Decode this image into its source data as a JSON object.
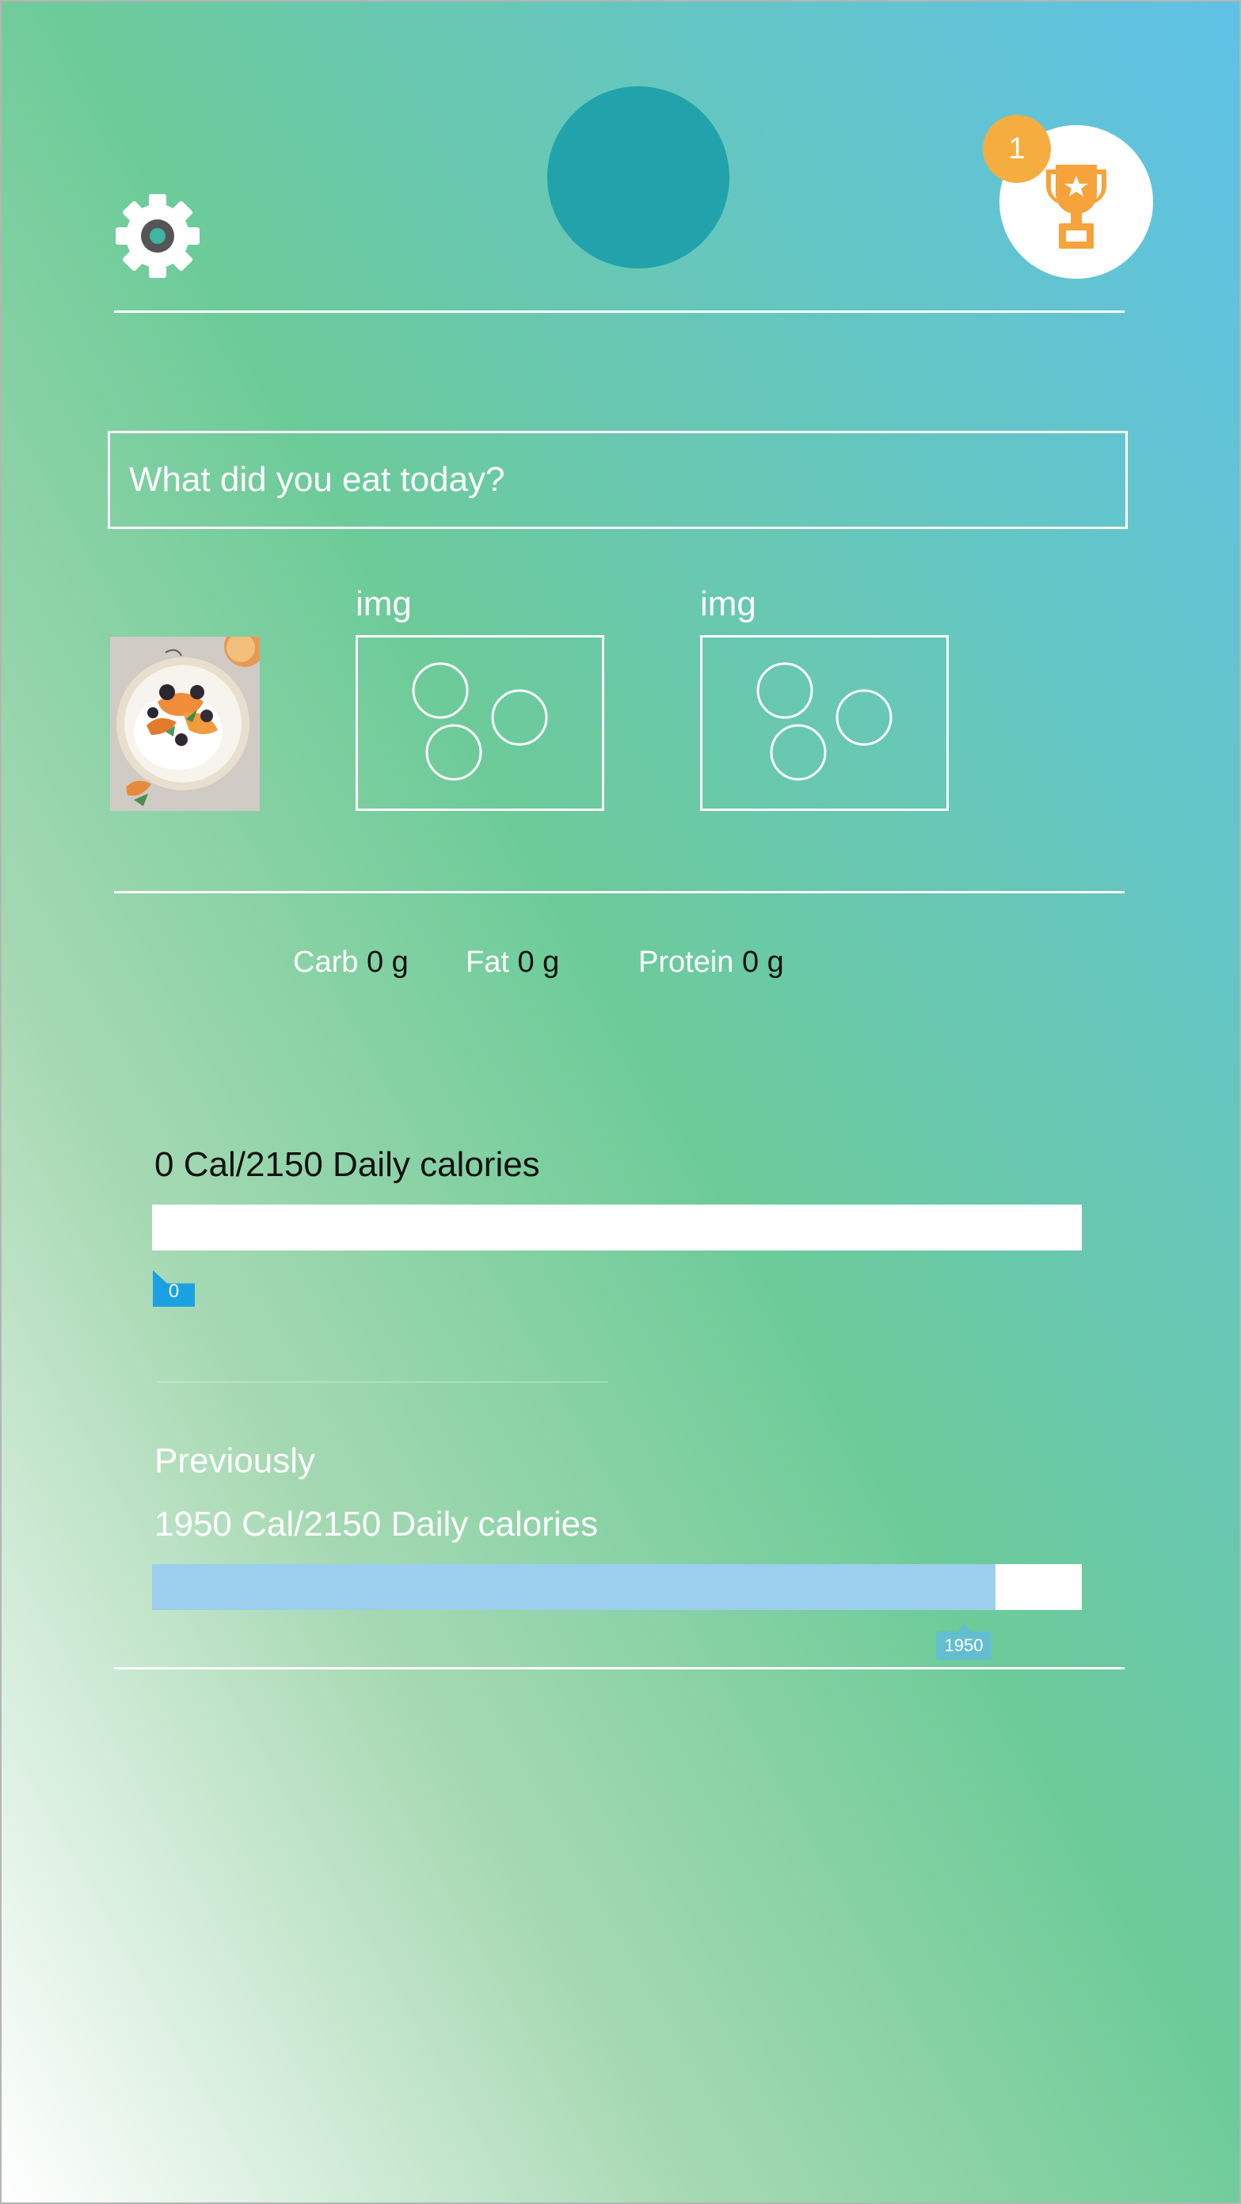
{
  "header": {
    "settings_icon": "gear-icon",
    "avatar_color": "#22a2ab",
    "achievements_icon": "trophy-icon",
    "achievements_badge_count": "1",
    "badge_color": "#f6ad3f"
  },
  "search": {
    "placeholder": "What did you eat today?"
  },
  "meal_images": {
    "photo_icon": "food-photo",
    "placeholders": [
      {
        "label": "img"
      },
      {
        "label": "img"
      }
    ]
  },
  "macros": {
    "carb": {
      "label": "Carb",
      "value": "0 g"
    },
    "fat": {
      "label": "Fat",
      "value": "0 g"
    },
    "protein": {
      "label": "Protein",
      "value": "0 g"
    }
  },
  "today": {
    "summary": "0 Cal/2150 Daily calories",
    "consumed": 0,
    "goal": 2150,
    "marker_label": "0"
  },
  "previously": {
    "heading": "Previously",
    "summary": "1950 Cal/2150 Daily calories",
    "consumed": 1950,
    "goal": 2150,
    "marker_label": "1950",
    "bar_color": "#9ccfee"
  }
}
